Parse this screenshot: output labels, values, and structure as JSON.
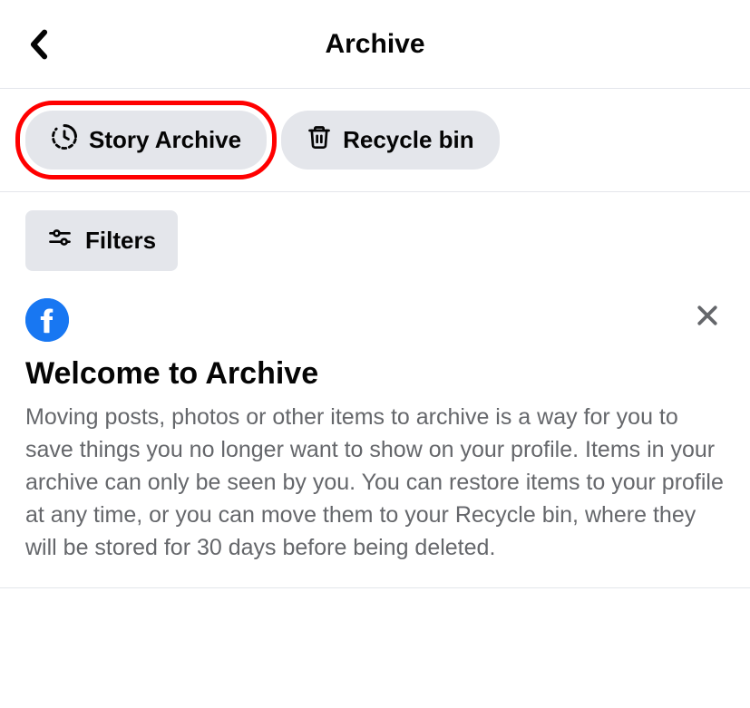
{
  "header": {
    "title": "Archive"
  },
  "tabs": {
    "story_archive": {
      "label": "Story Archive"
    },
    "recycle_bin": {
      "label": "Recycle bin"
    }
  },
  "filters": {
    "label": "Filters"
  },
  "welcome": {
    "title": "Welcome to Archive",
    "body": "Moving posts, photos or other items to archive is a way for you to save things you no longer want to show on your profile. Items in your archive can only be seen by you. You can restore items to your profile at any time, or you can move them to your Recycle bin, where they will be stored for 30 days before being deleted."
  }
}
